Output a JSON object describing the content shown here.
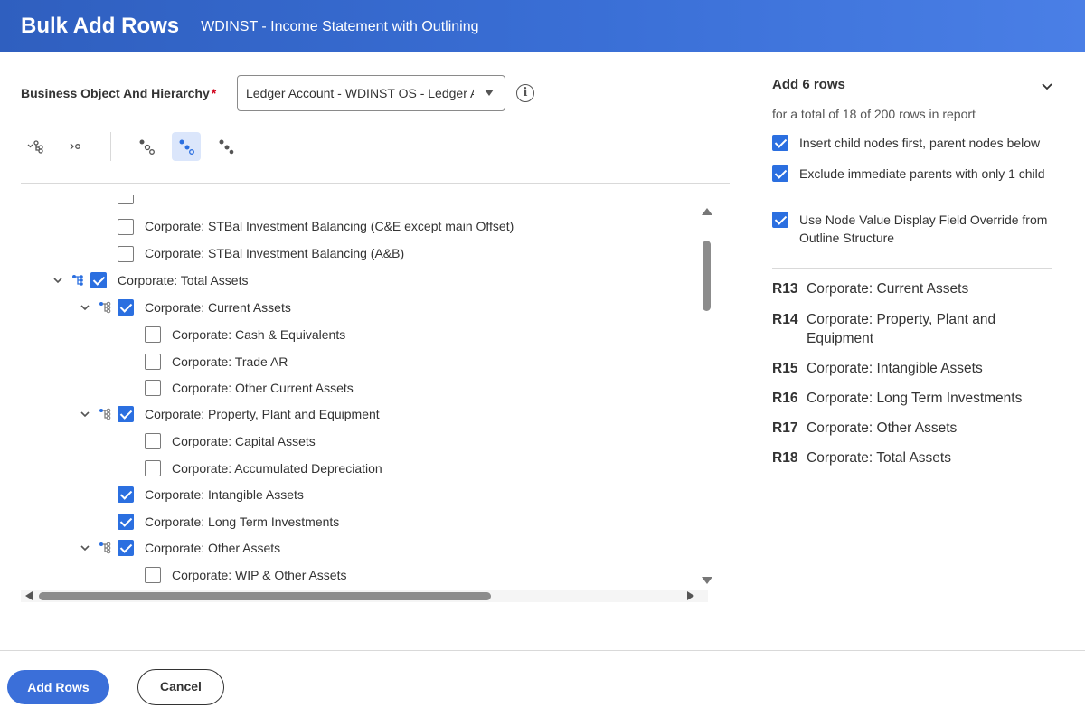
{
  "header": {
    "title": "Bulk Add Rows",
    "subtitle": "WDINST - Income Statement with Outlining"
  },
  "form": {
    "field_label": "Business Object And Hierarchy",
    "required_marker": "*",
    "select_value": "Ledger Account - WDINST OS - Ledger Account",
    "info_icon": "info-icon"
  },
  "toolbar": {
    "icons": [
      "expand-hierarchy-icon",
      "collapse-icon",
      "select-nodes-icon",
      "select-children-icon",
      "select-parents-icon"
    ],
    "active_index": 3
  },
  "tree": {
    "rows": [
      {
        "label": "Corporate: STBal Investment Balancing (C&E except main Offset)",
        "checked": false,
        "expandable": false
      },
      {
        "label": "Corporate: STBal Investment Balancing (A&B)",
        "checked": false,
        "expandable": false
      },
      {
        "label": "Corporate: Total Assets",
        "checked": true,
        "expandable": true
      },
      {
        "label": "Corporate: Current Assets",
        "checked": true,
        "expandable": true
      },
      {
        "label": "Corporate: Cash & Equivalents",
        "checked": false,
        "expandable": false
      },
      {
        "label": "Corporate: Trade AR",
        "checked": false,
        "expandable": false
      },
      {
        "label": "Corporate: Other Current Assets",
        "checked": false,
        "expandable": false
      },
      {
        "label": "Corporate: Property, Plant and Equipment",
        "checked": true,
        "expandable": true
      },
      {
        "label": "Corporate: Capital Assets",
        "checked": false,
        "expandable": false
      },
      {
        "label": "Corporate: Accumulated Depreciation",
        "checked": false,
        "expandable": false
      },
      {
        "label": "Corporate: Intangible Assets",
        "checked": true,
        "expandable": false
      },
      {
        "label": "Corporate: Long Term Investments",
        "checked": true,
        "expandable": false
      },
      {
        "label": "Corporate: Other Assets",
        "checked": true,
        "expandable": true
      },
      {
        "label": "Corporate: WIP & Other Assets",
        "checked": false,
        "expandable": false
      }
    ]
  },
  "summary": {
    "title": "Add 6 rows",
    "subtitle": "for a total of 18 of 200 rows in report",
    "options": [
      {
        "label": "Insert child nodes first, parent nodes below",
        "checked": true
      },
      {
        "label": "Exclude immediate parents with only 1 child",
        "checked": true
      },
      {
        "label": "Use Node Value Display Field Override from Outline Structure",
        "checked": true
      }
    ],
    "results": [
      {
        "row": "R13",
        "label": "Corporate: Current Assets"
      },
      {
        "row": "R14",
        "label": "Corporate: Property, Plant and Equipment"
      },
      {
        "row": "R15",
        "label": "Corporate: Intangible Assets"
      },
      {
        "row": "R16",
        "label": "Corporate: Long Term Investments"
      },
      {
        "row": "R17",
        "label": "Corporate: Other Assets"
      },
      {
        "row": "R18",
        "label": "Corporate: Total Assets"
      }
    ]
  },
  "footer": {
    "primary_label": "Add Rows",
    "secondary_label": "Cancel"
  },
  "colors": {
    "accent": "#3b6fd9",
    "checkbox": "#2b6fe0",
    "header_gradient_start": "#2f5fbf",
    "header_gradient_end": "#4a7fe6"
  }
}
